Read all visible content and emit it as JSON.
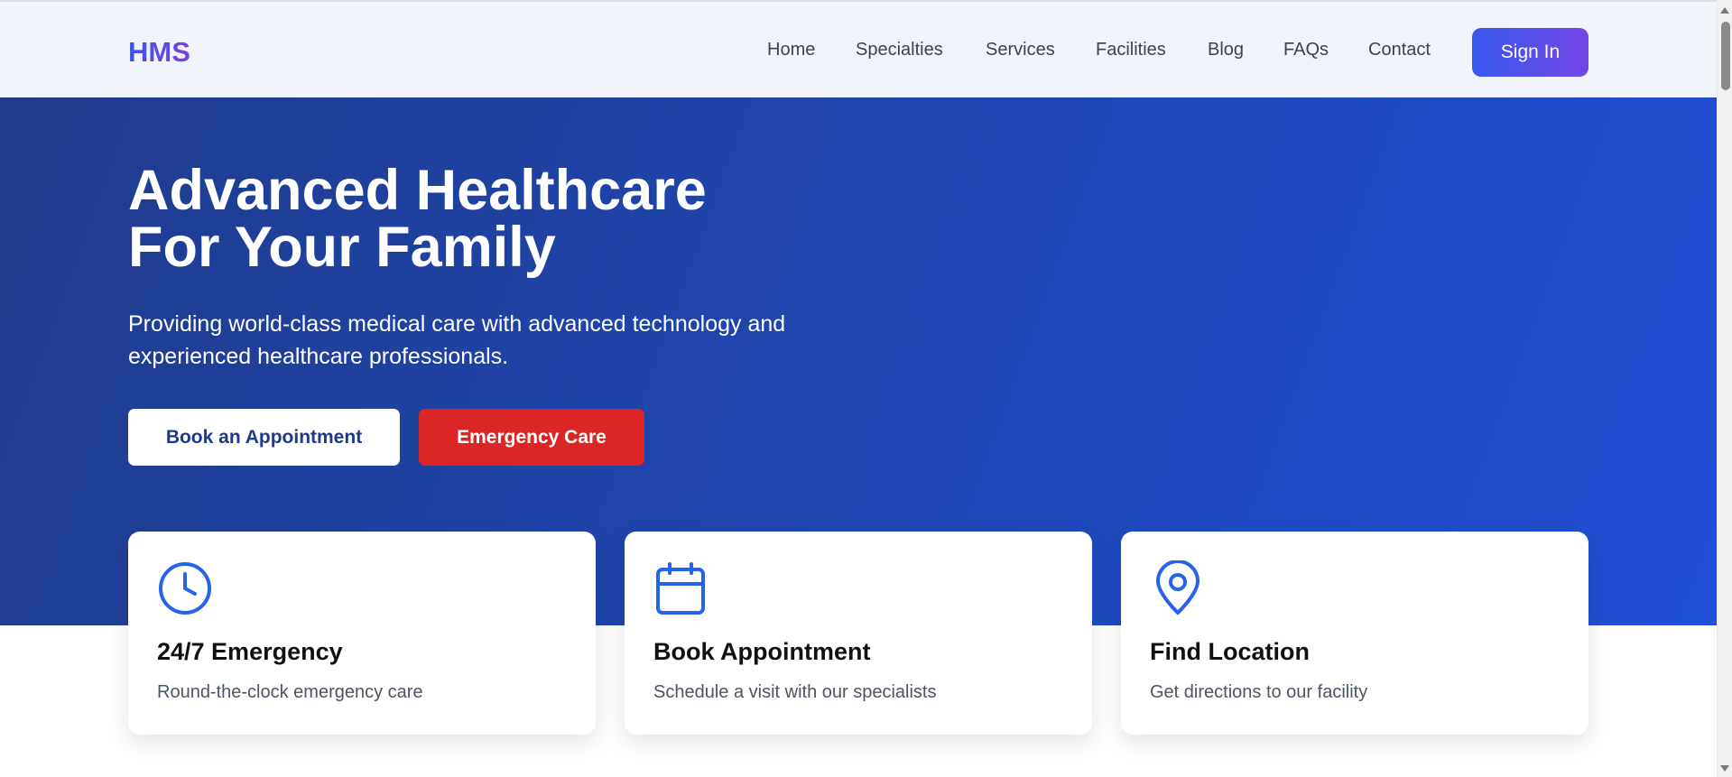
{
  "brand": {
    "name": "HMS"
  },
  "nav": {
    "items": [
      "Home",
      "Specialties",
      "Services",
      "Facilities",
      "Blog",
      "FAQs",
      "Contact"
    ],
    "signin_label": "Sign In"
  },
  "hero": {
    "title_line1": "Advanced Healthcare",
    "title_line2": "For Your Family",
    "subtitle": "Providing world-class medical care with advanced technology and experienced healthcare professionals.",
    "primary_button": "Book an Appointment",
    "secondary_button": "Emergency Care"
  },
  "cards": [
    {
      "icon": "clock-icon",
      "title": "24/7 Emergency",
      "description": "Round-the-clock emergency care"
    },
    {
      "icon": "calendar-icon",
      "title": "Book Appointment",
      "description": "Schedule a visit with our specialists"
    },
    {
      "icon": "map-pin-icon",
      "title": "Find Location",
      "description": "Get directions to our facility"
    }
  ],
  "colors": {
    "accent": "#2563eb",
    "hero_start": "#1f3b8c",
    "hero_end": "#1f4fd6",
    "emergency": "#dc2626",
    "brand_gradient_start": "#3b55e6",
    "brand_gradient_end": "#7b3fe4"
  }
}
